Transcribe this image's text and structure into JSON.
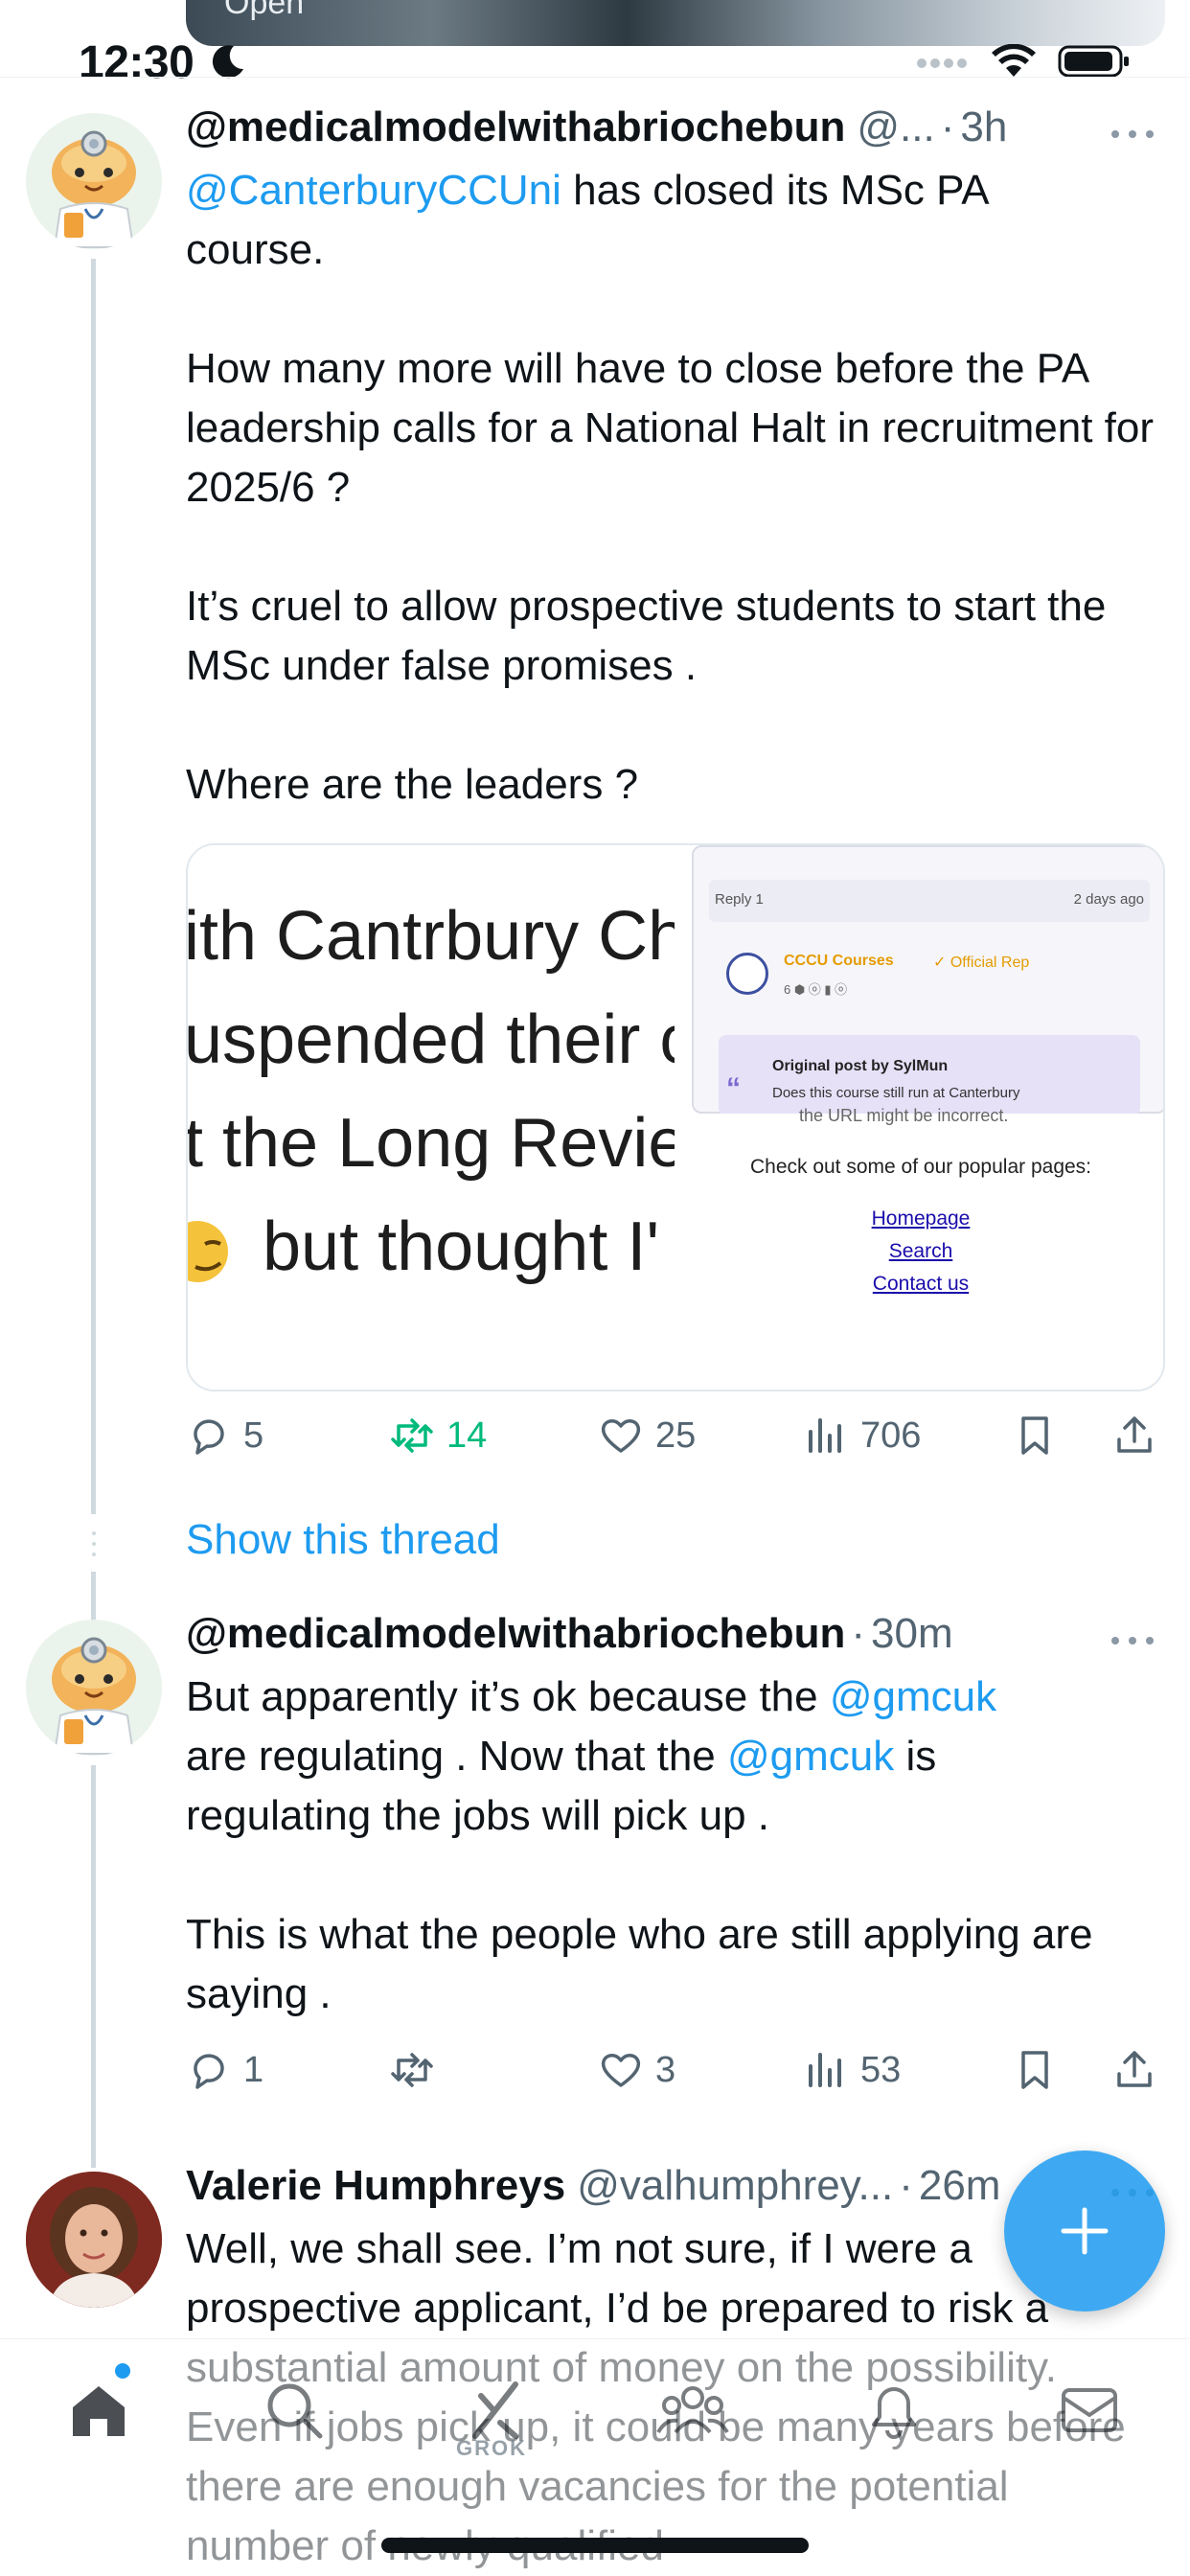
{
  "status_bar": {
    "time": "12:30",
    "media_strip_label": "Open"
  },
  "tweets": [
    {
      "display_name": "@medicalmodelwithabriochebun",
      "handle": "@...",
      "time": "3h",
      "text_parts": [
        {
          "type": "mention",
          "text": "@CanterburyCCUni"
        },
        {
          "type": "text",
          "text": " has closed its MSc PA\ncourse.\n\nHow many more will have to close before the PA leadership calls for a National Halt in recruitment for 2025/6 ?\n\nIt’s cruel to allow prospective students to start the MSc under false promises .\n\nWhere are the leaders ?"
        }
      ],
      "media": {
        "left_lines": [
          "ith Cantrbury Ch",
          "uspended their c",
          "t the Long Revie",
          "but thought I'"
        ],
        "reply_label": "Reply 1",
        "reply_age": "2 days ago",
        "account_name": "CCCU Courses",
        "account_badge": "✓ Official Rep",
        "account_stats": "6 ⬢ ⓞ ▮ ⓞ",
        "quote_title": "Original post by SylMun",
        "quote_text": "Does this course still run at Canterbury",
        "cut_text": "the URL might be incorrect.",
        "popular_title": "Check out some of our popular pages:",
        "links": [
          "Homepage",
          "Search",
          "Contact us"
        ]
      },
      "actions": {
        "replies": "5",
        "retweets": "14",
        "likes": "25",
        "views": "706"
      }
    },
    {
      "display_name": "@medicalmodelwithabriochebun",
      "time": "30m",
      "text_line1_a": "But apparently it’s ok because the ",
      "mention_1": "@gmcuk",
      "text_line2_a": "are regulating . Now that the ",
      "mention_2": "@gmcuk",
      "text_line2_b": " is",
      "text_rest": "regulating the jobs will pick up .\n\nThis is what the people who are still applying are saying .",
      "actions": {
        "replies": "1",
        "retweets": "",
        "likes": "3",
        "views": "53"
      }
    },
    {
      "display_name": "Valerie Humphreys",
      "handle": "@valhumphrey...",
      "time": "26m",
      "text": "Well, we shall see. I’m not sure, if I were a prospective applicant, I’d be prepared to risk a substantial amount of money on the possibility. Even if jobs pick up, it could be many years before there are enough vacancies for the potential number of newly qualified"
    }
  ],
  "show_thread": "Show this thread",
  "bottom_nav": {
    "grok_label": "GROK",
    "items": [
      "home",
      "search",
      "grok",
      "communities",
      "notifications",
      "messages"
    ]
  },
  "colors": {
    "accent": "#1d9bf0",
    "retweet_active": "#00ba7c",
    "muted": "#536471",
    "text": "#0f1419"
  }
}
